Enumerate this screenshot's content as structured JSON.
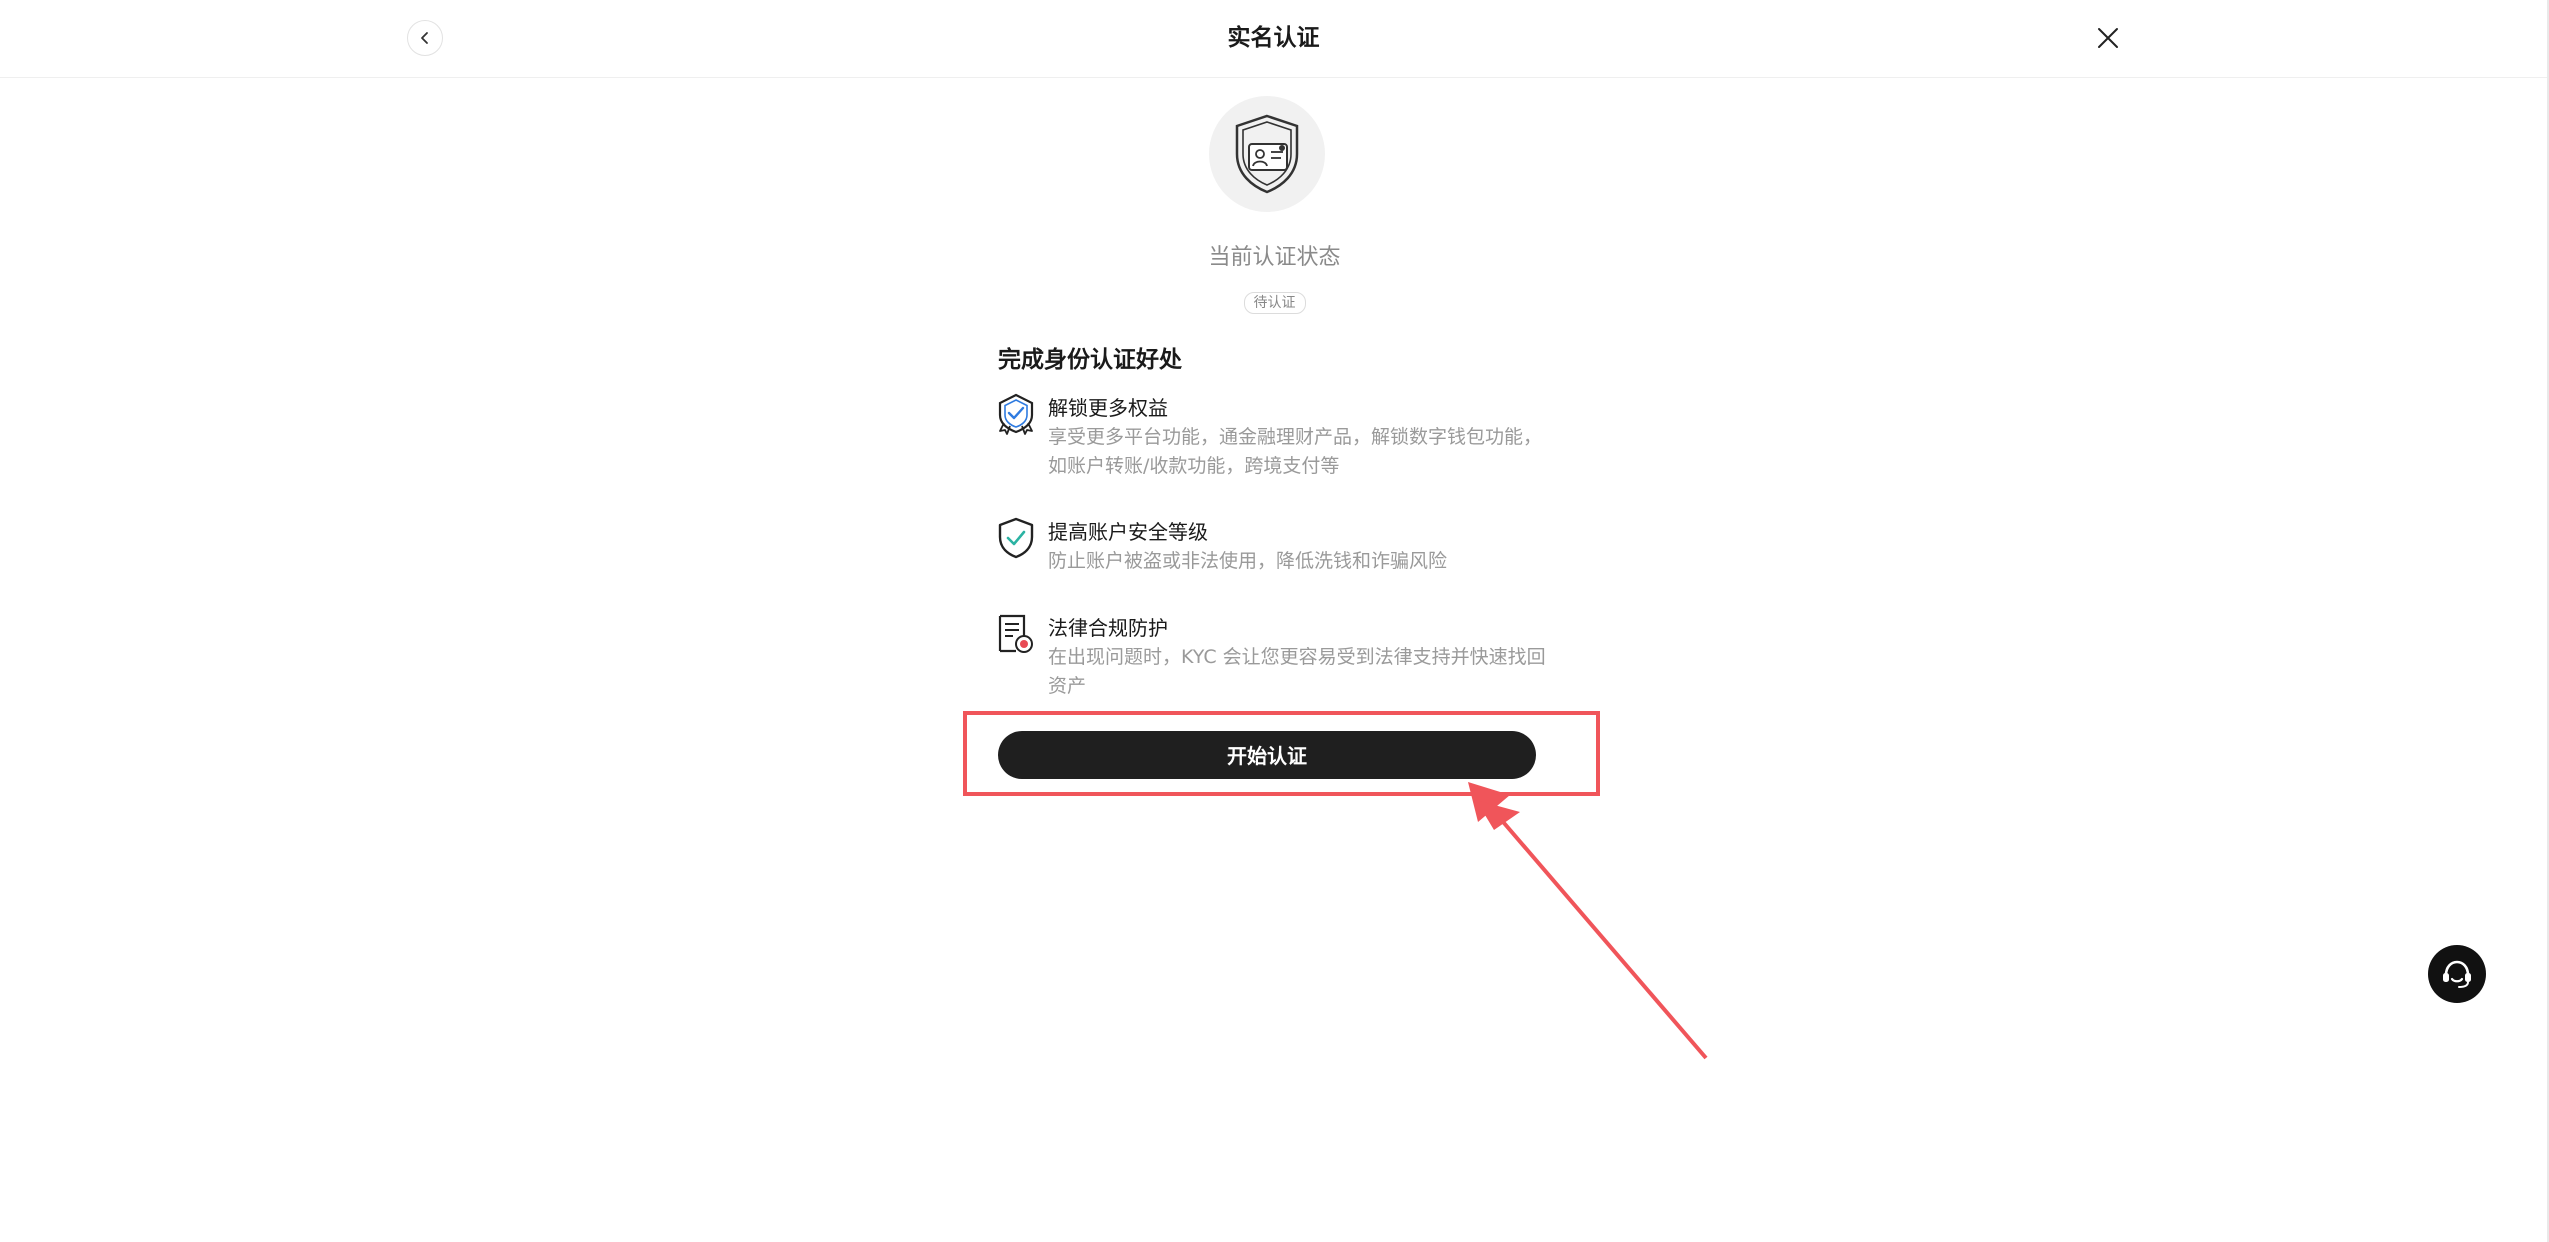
{
  "header": {
    "title": "实名认证",
    "back_icon": "chevron-left-icon",
    "close_icon": "close-icon"
  },
  "status": {
    "hero_icon": "id-card-shield-icon",
    "caption": "当前认证状态",
    "badge": "待认证"
  },
  "benefits": {
    "heading": "完成身份认证好处",
    "items": [
      {
        "icon": "badge-check-icon",
        "title": "解锁更多权益",
        "desc": "享受更多平台功能，通金融理财产品，解锁数字钱包功能，如账户转账/收款功能，跨境支付等"
      },
      {
        "icon": "shield-check-icon",
        "title": "提高账户安全等级",
        "desc": "防止账户被盗或非法使用，降低洗钱和诈骗风险"
      },
      {
        "icon": "legal-document-icon",
        "title": "法律合规防护",
        "desc": "在出现问题时，KYC 会让您更容易受到法律支持并快速找回资产"
      }
    ]
  },
  "cta": {
    "label": "开始认证"
  },
  "support": {
    "icon": "headset-icon"
  },
  "colors": {
    "accent_dark": "#1f1f1f",
    "annotation_red": "#f0555a",
    "check_teal": "#2bb3a3",
    "check_blue": "#2f7be0"
  }
}
